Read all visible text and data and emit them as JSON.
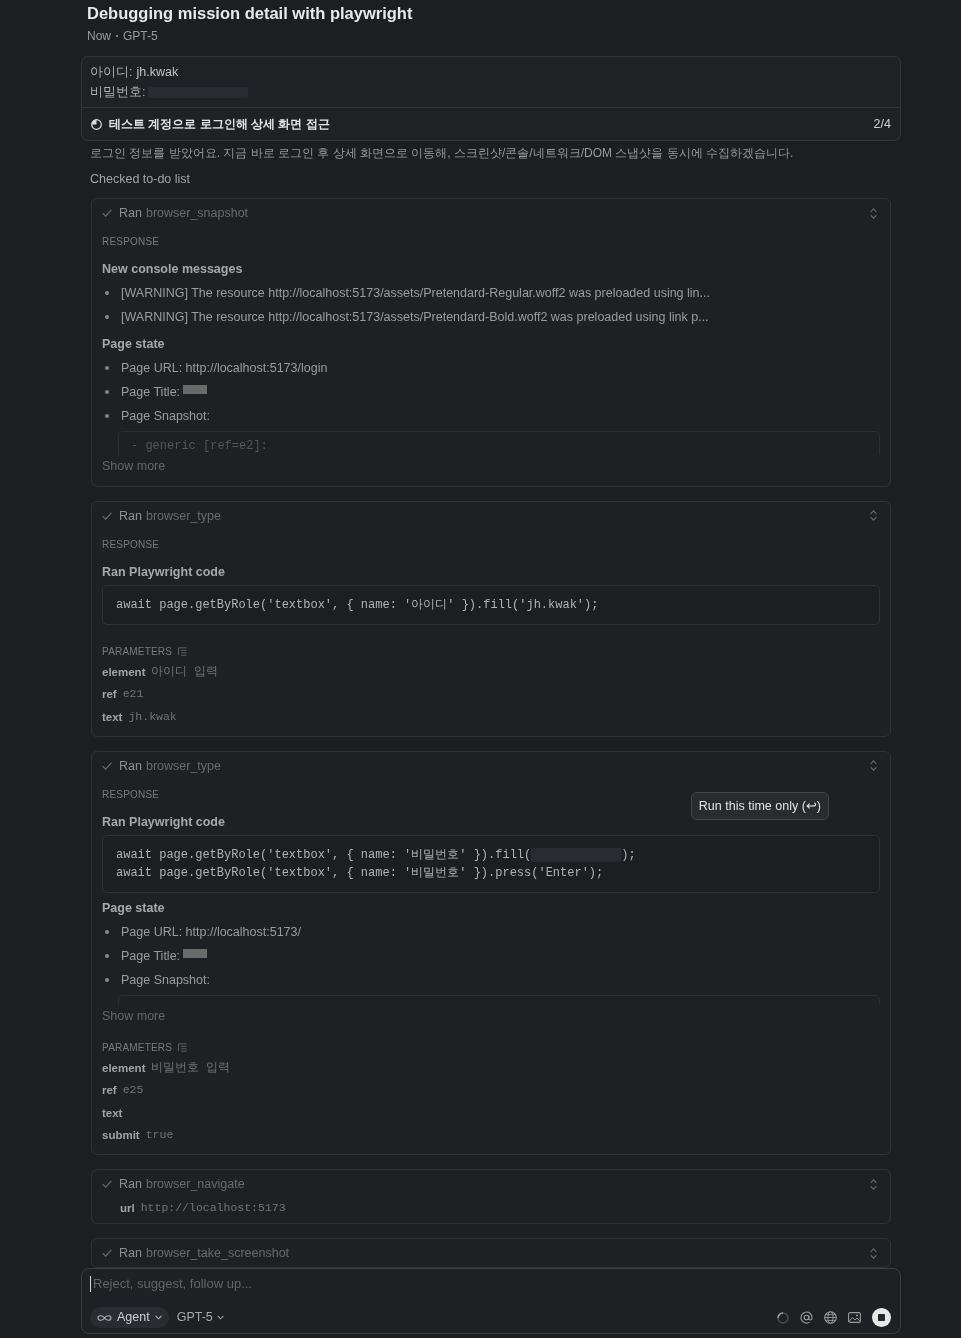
{
  "conversation": {
    "title": "Debugging mission detail with playwright",
    "time": "Now",
    "model": "GPT-5"
  },
  "user_message": {
    "fields": [
      {
        "label": "아이디:",
        "value": "jh.kwak",
        "redacted": false
      },
      {
        "label": "비밀번호:",
        "redacted": true
      }
    ]
  },
  "todo": {
    "label": "테스트 계정으로 로그인해 상세 화면 접근",
    "count": "2/4"
  },
  "assistant_text": "로그인 정보를 받았어요. 지금 바로 로그인 후 상세 화면으로 이동해, 스크린샷/콘솔/네트워크/DOM 스냅샷을 동시에 수집하겠습니다.",
  "status_line": "Checked to-do list",
  "tool_calls": [
    {
      "kind": "expanded",
      "verb": "Ran",
      "tool": "browser_snapshot",
      "blocks": [
        {
          "kind": "label",
          "text": "RESPONSE"
        },
        {
          "kind": "heading",
          "text": "New console messages"
        },
        {
          "kind": "bullet",
          "text": "[WARNING] The resource http://localhost:5173/assets/Pretendard-Regular.woff2 was preloaded using lin...",
          "redacted": false
        },
        {
          "kind": "bullet",
          "text": "[WARNING] The resource http://localhost:5173/assets/Pretendard-Bold.woff2 was preloaded using link p...",
          "redacted": false
        },
        {
          "kind": "heading",
          "text": "Page state"
        },
        {
          "kind": "bullet",
          "text": "Page URL: http://localhost:5173/login",
          "redacted": false
        },
        {
          "kind": "bullet",
          "text": "Page Title:",
          "redacted": true
        },
        {
          "kind": "bullet",
          "text": "Page Snapshot:",
          "redacted": false
        },
        {
          "kind": "snapshot",
          "text": "- generic [ref=e2]:"
        },
        {
          "kind": "more",
          "text": "Show more"
        }
      ]
    },
    {
      "kind": "expanded",
      "verb": "Ran",
      "tool": "browser_type",
      "blocks": [
        {
          "kind": "label",
          "text": "RESPONSE"
        },
        {
          "kind": "heading",
          "text": "Ran Playwright code"
        },
        {
          "kind": "code",
          "lines": [
            {
              "segments": [
                {
                  "text": "await page.getByRole('textbox', { name: '아이디' }).fill('jh.kwak');",
                  "redacted": false
                }
              ]
            }
          ]
        },
        {
          "kind": "params_label",
          "text": "PARAMETERS"
        },
        {
          "kind": "param",
          "name": "element",
          "value": "아이디 입력"
        },
        {
          "kind": "param",
          "name": "ref",
          "value": "e21"
        },
        {
          "kind": "param",
          "name": "text",
          "value": "jh.kwak"
        }
      ]
    },
    {
      "kind": "expanded",
      "verb": "Ran",
      "tool": "browser_type",
      "tooltip": "Run this time only (↩)",
      "blocks": [
        {
          "kind": "label",
          "text": "RESPONSE"
        },
        {
          "kind": "heading",
          "text": "Ran Playwright code"
        },
        {
          "kind": "code",
          "lines": [
            {
              "segments": [
                {
                  "text": "await page.getByRole('textbox', { name: '비밀번호' }).fill(",
                  "redacted": false
                },
                {
                  "redacted": true
                },
                {
                  "text": ");",
                  "redacted": false
                }
              ]
            },
            {
              "segments": [
                {
                  "text": "await page.getByRole('textbox', { name: '비밀번호' }).press('Enter');",
                  "redacted": false
                }
              ]
            }
          ]
        },
        {
          "kind": "heading",
          "text": "Page state"
        },
        {
          "kind": "bullet",
          "text": "Page URL: http://localhost:5173/",
          "redacted": false
        },
        {
          "kind": "bullet",
          "text": "Page Title:",
          "redacted": true
        },
        {
          "kind": "bullet",
          "text": "Page Snapshot:",
          "redacted": false
        },
        {
          "kind": "snapshot"
        },
        {
          "kind": "more",
          "text": "Show more"
        },
        {
          "kind": "params_label",
          "text": "PARAMETERS"
        },
        {
          "kind": "param",
          "name": "element",
          "value": "비밀번호 입력"
        },
        {
          "kind": "param",
          "name": "ref",
          "value": "e25"
        },
        {
          "kind": "param",
          "name": "text"
        },
        {
          "kind": "param",
          "name": "submit",
          "value": "true"
        }
      ]
    },
    {
      "kind": "summary",
      "verb": "Ran",
      "tool": "browser_navigate",
      "blocks": [
        {
          "kind": "param",
          "name": "url",
          "value": "http://localhost:5173"
        }
      ]
    },
    {
      "kind": "summary",
      "verb": "Ran",
      "tool": "browser_take_screenshot"
    }
  ],
  "composer": {
    "placeholder": "Reject, suggest, follow up...",
    "focused": true,
    "mode": "Agent",
    "model": "GPT-5",
    "busy": true
  }
}
